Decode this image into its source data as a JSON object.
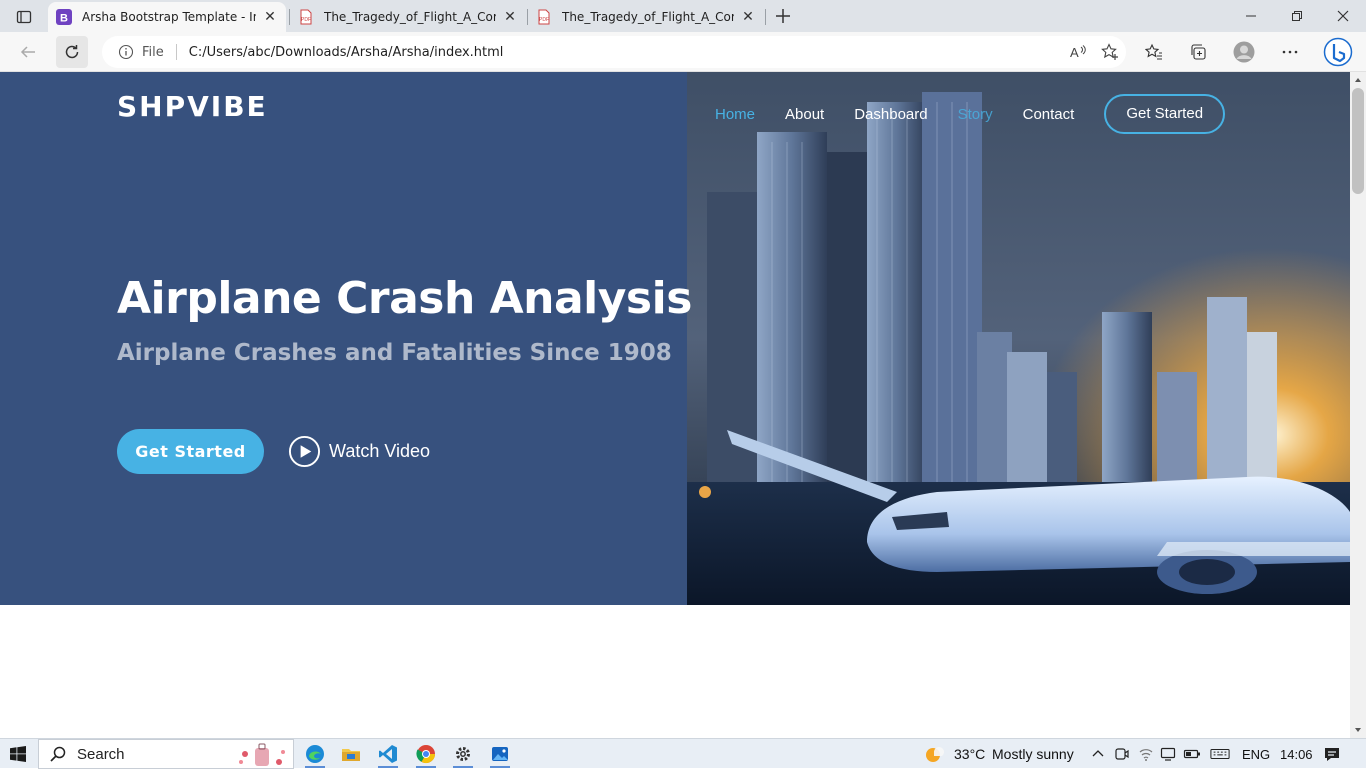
{
  "browser": {
    "tabs": [
      {
        "title": "Arsha Bootstrap Template - Index",
        "favicon": "bootstrap-b-icon",
        "active": true
      },
      {
        "title": "The_Tragedy_of_Flight_A_Comprehensive",
        "favicon": "pdf-icon",
        "active": false
      },
      {
        "title": "The_Tragedy_of_Flight_A_Comprehensive",
        "favicon": "pdf-icon",
        "active": false
      }
    ],
    "address": {
      "scheme": "File",
      "url": "C:/Users/abc/Downloads/Arsha/Arsha/index.html"
    }
  },
  "site": {
    "logo": "SHPVIBE",
    "nav": {
      "home": "Home",
      "about": "About",
      "dashboard": "Dashboard",
      "story": "Story",
      "contact": "Contact",
      "cta": "Get Started"
    },
    "hero": {
      "title": "Airplane Crash Analysis",
      "subtitle": "Airplane Crashes and Fatalities Since 1908",
      "primary_button": "Get Started",
      "video_button": "Watch Video"
    },
    "colors": {
      "hero_bg": "#37517e",
      "accent": "#47b2e4"
    }
  },
  "taskbar": {
    "search_label": "Search",
    "weather_temp": "33°C",
    "weather_desc": "Mostly sunny",
    "language": "ENG",
    "time": "14:06"
  }
}
